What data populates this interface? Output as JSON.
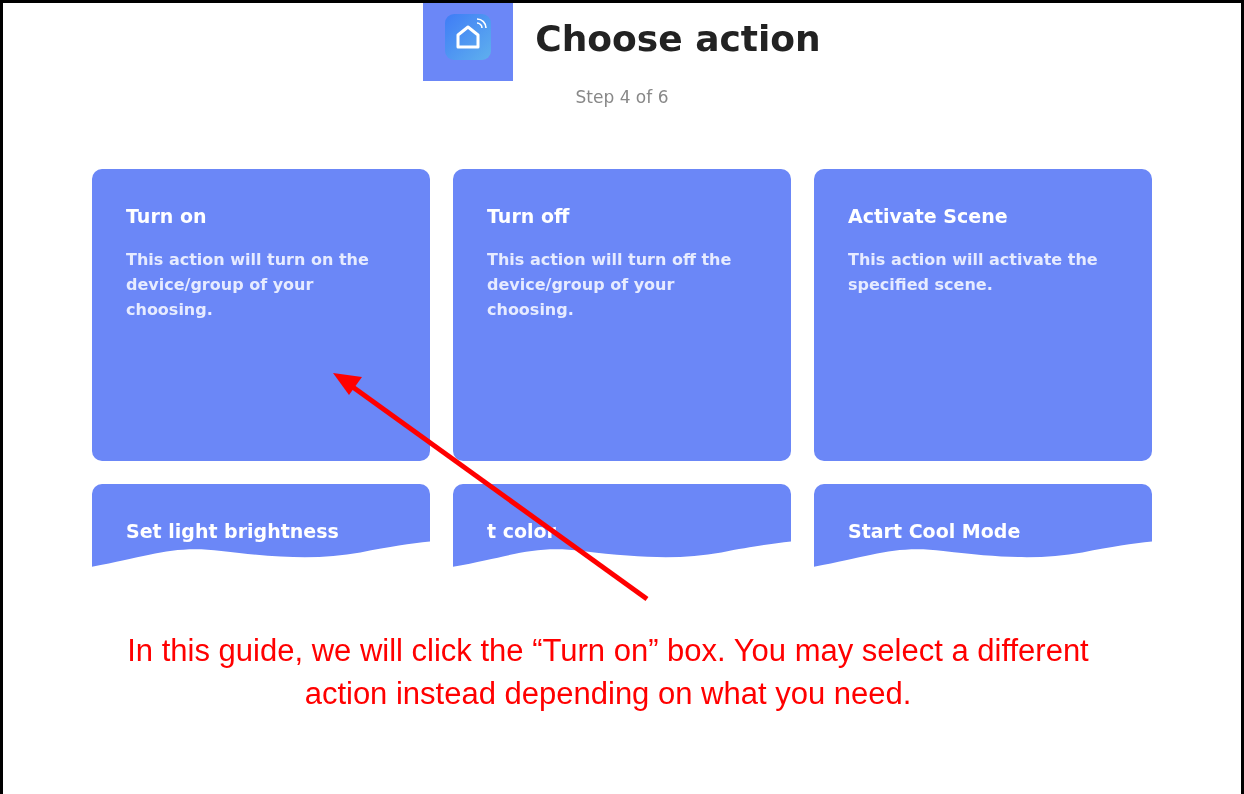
{
  "header": {
    "title": "Choose action",
    "step": "Step 4 of 6"
  },
  "cards": [
    {
      "title": "Turn on",
      "description": "This action will turn on the device/group of your choosing.",
      "torn": false
    },
    {
      "title": "Turn off",
      "description": "This action will turn off the device/group of your choosing.",
      "torn": false
    },
    {
      "title": "Activate Scene",
      "description": "This action will activate the specified scene.",
      "torn": false
    },
    {
      "title": "Set light brightness",
      "torn": true
    },
    {
      "title": "t color",
      "torn": true
    },
    {
      "title": "Start Cool Mode",
      "torn": true
    }
  ],
  "annotation": {
    "caption": "In this guide, we will click the “Turn on” box. You may select a different action instead depending on what you need."
  }
}
